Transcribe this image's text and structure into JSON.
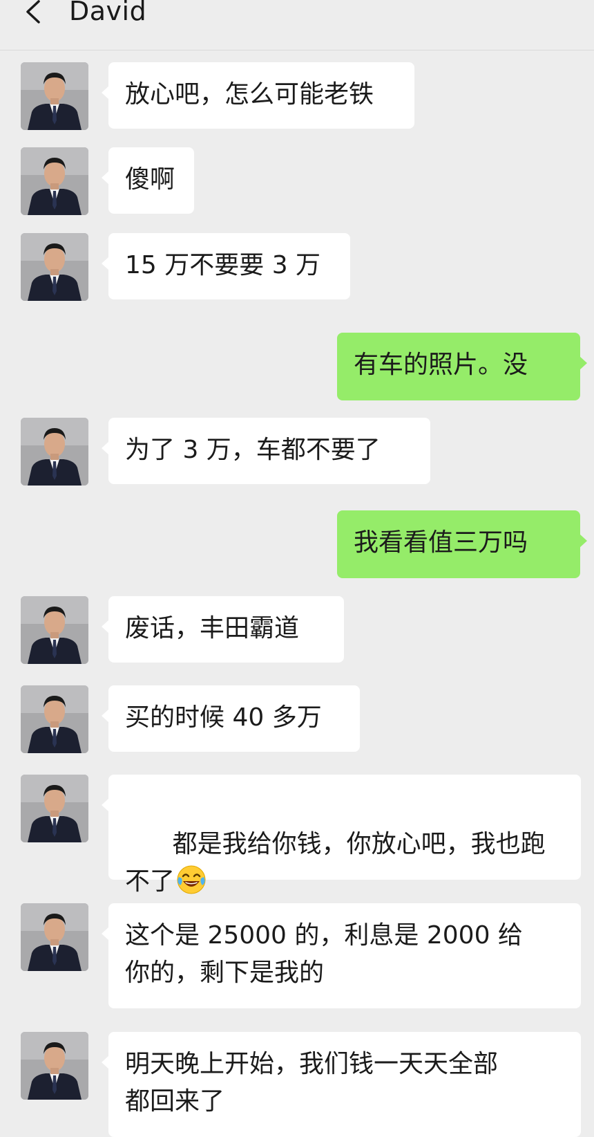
{
  "header": {
    "title": "David"
  },
  "messages": [
    {
      "side": "recv",
      "text": "放心吧，怎么可能老铁"
    },
    {
      "side": "recv",
      "text": "傻啊"
    },
    {
      "side": "recv",
      "text": "15 万不要要 3 万"
    },
    {
      "side": "sent",
      "text": "有车的照片。没"
    },
    {
      "side": "recv",
      "text": "为了 3 万，车都不要了"
    },
    {
      "side": "sent",
      "text": "我看看值三万吗"
    },
    {
      "side": "recv",
      "text": "废话，丰田霸道"
    },
    {
      "side": "recv",
      "text": "买的时候 40 多万"
    },
    {
      "side": "recv",
      "text": "都是我给你钱，你放心吧，我也跑\n不了",
      "emoji": "laughing-tears-emoji"
    },
    {
      "side": "recv",
      "text": "这个是 25000 的，利息是 2000 给\n你的，剩下是我的"
    },
    {
      "side": "recv",
      "text": "明天晚上开始，我们钱一天天全部\n都回来了"
    }
  ]
}
